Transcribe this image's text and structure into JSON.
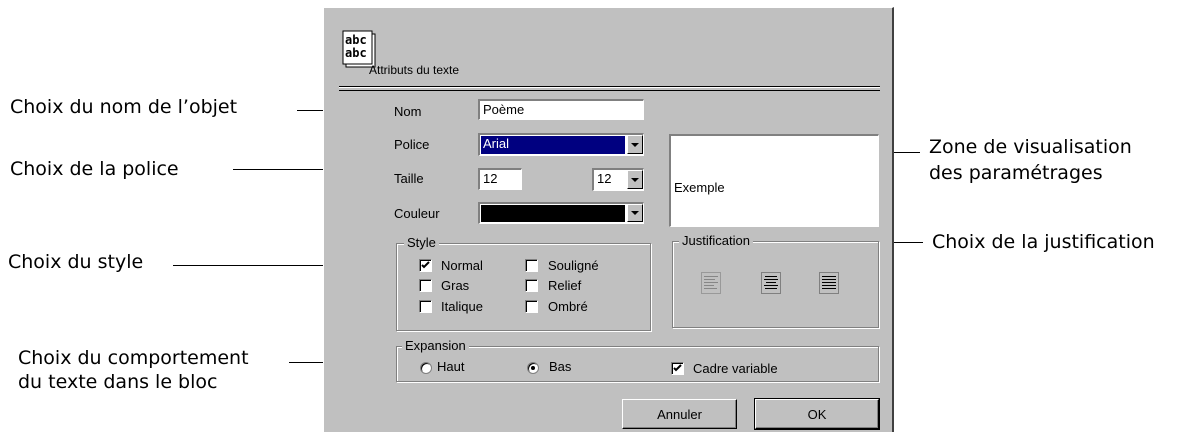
{
  "annotations": {
    "object_name": "Choix du nom de l’objet",
    "font": "Choix de la police",
    "style": "Choix du style",
    "behavior_line1": "Choix du comportement",
    "behavior_line2": "du texte dans le bloc",
    "preview_line1": "Zone de visualisation",
    "preview_line2": "des paramétrages",
    "justification": "Choix de la justification"
  },
  "dialog": {
    "icon_text": "abc",
    "title": "Attributs du texte",
    "name_label": "Nom",
    "name_value": "Poème",
    "font_label": "Police",
    "font_value": "Arial",
    "size_label": "Taille",
    "size_value": "12",
    "size_dropdown_value": "12",
    "color_label": "Couleur",
    "color_value": "#000000",
    "preview_text": "Exemple",
    "style": {
      "legend": "Style",
      "options": [
        {
          "label": "Normal",
          "checked": true
        },
        {
          "label": "Gras",
          "checked": false
        },
        {
          "label": "Italique",
          "checked": false
        },
        {
          "label": "Souligné",
          "checked": false
        },
        {
          "label": "Relief",
          "checked": false
        },
        {
          "label": "Ombré",
          "checked": false
        }
      ]
    },
    "justification": {
      "legend": "Justification",
      "options": [
        "left-justify-icon",
        "center-justify-icon",
        "full-justify-icon"
      ]
    },
    "expansion": {
      "legend": "Expansion",
      "haut": "Haut",
      "bas": "Bas",
      "selected": "Bas",
      "variable_frame": "Cadre variable",
      "variable_frame_checked": true
    },
    "cancel": "Annuler",
    "ok": "OK"
  },
  "colors": {
    "dialog_bg": "#c0c0c0",
    "selection": "#000080"
  }
}
